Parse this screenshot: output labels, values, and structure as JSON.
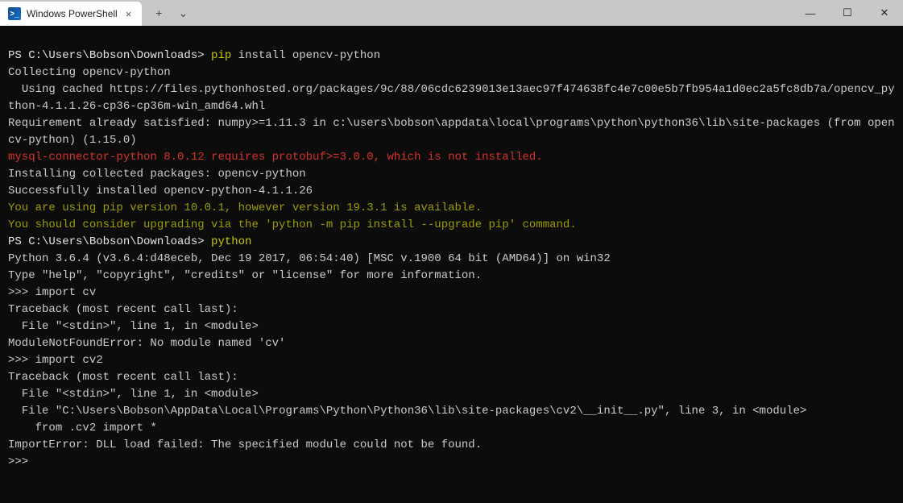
{
  "titlebar": {
    "tab_title": "Windows PowerShell",
    "tab_icon_text": ">_",
    "close_tab": "×",
    "new_tab": "+",
    "dropdown": "⌄",
    "minimize": "—",
    "maximize": "☐",
    "close": "✕"
  },
  "terminal": {
    "lines": [
      {
        "segments": [
          {
            "t": " ",
            "c": ""
          }
        ]
      },
      {
        "segments": [
          {
            "t": "PS C:\\Users\\Bobson\\Downloads> ",
            "c": "prompt-white"
          },
          {
            "t": "pip",
            "c": "c-yellow"
          },
          {
            "t": " install opencv-python",
            "c": ""
          }
        ]
      },
      {
        "segments": [
          {
            "t": "Collecting opencv-python",
            "c": ""
          }
        ]
      },
      {
        "segments": [
          {
            "t": "  Using cached https://files.pythonhosted.org/packages/9c/88/06cdc6239013e13aec97f474638fc4e7c00e5b7fb954a1d0ec2a5fc8db7a/opencv_python-4.1.1.26-cp36-cp36m-win_amd64.whl",
            "c": ""
          }
        ]
      },
      {
        "segments": [
          {
            "t": "Requirement already satisfied: numpy>=1.11.3 in c:\\users\\bobson\\appdata\\local\\programs\\python\\python36\\lib\\site-packages (from opencv-python) (1.15.0)",
            "c": ""
          }
        ]
      },
      {
        "segments": [
          {
            "t": "mysql-connector-python 8.0.12 requires protobuf>=3.0.0, which is not installed.",
            "c": "c-red"
          }
        ]
      },
      {
        "segments": [
          {
            "t": "Installing collected packages: opencv-python",
            "c": ""
          }
        ]
      },
      {
        "segments": [
          {
            "t": "Successfully installed opencv-python-4.1.1.26",
            "c": ""
          }
        ]
      },
      {
        "segments": [
          {
            "t": "You are using pip version 10.0.1, however version 19.3.1 is available.",
            "c": "c-dimyellow"
          }
        ]
      },
      {
        "segments": [
          {
            "t": "You should consider upgrading via the 'python -m pip install --upgrade pip' command.",
            "c": "c-dimyellow"
          }
        ]
      },
      {
        "segments": [
          {
            "t": "PS C:\\Users\\Bobson\\Downloads> ",
            "c": "prompt-white"
          },
          {
            "t": "python",
            "c": "c-yellow"
          }
        ]
      },
      {
        "segments": [
          {
            "t": "Python 3.6.4 (v3.6.4:d48eceb, Dec 19 2017, 06:54:40) [MSC v.1900 64 bit (AMD64)] on win32",
            "c": ""
          }
        ]
      },
      {
        "segments": [
          {
            "t": "Type \"help\", \"copyright\", \"credits\" or \"license\" for more information.",
            "c": ""
          }
        ]
      },
      {
        "segments": [
          {
            "t": ">>> import cv",
            "c": ""
          }
        ]
      },
      {
        "segments": [
          {
            "t": "Traceback (most recent call last):",
            "c": ""
          }
        ]
      },
      {
        "segments": [
          {
            "t": "  File \"<stdin>\", line 1, in <module>",
            "c": ""
          }
        ]
      },
      {
        "segments": [
          {
            "t": "ModuleNotFoundError: No module named 'cv'",
            "c": ""
          }
        ]
      },
      {
        "segments": [
          {
            "t": ">>> import cv2",
            "c": ""
          }
        ]
      },
      {
        "segments": [
          {
            "t": "Traceback (most recent call last):",
            "c": ""
          }
        ]
      },
      {
        "segments": [
          {
            "t": "  File \"<stdin>\", line 1, in <module>",
            "c": ""
          }
        ]
      },
      {
        "segments": [
          {
            "t": "  File \"C:\\Users\\Bobson\\AppData\\Local\\Programs\\Python\\Python36\\lib\\site-packages\\cv2\\__init__.py\", line 3, in <module>",
            "c": ""
          }
        ]
      },
      {
        "segments": [
          {
            "t": "    from .cv2 import *",
            "c": ""
          }
        ]
      },
      {
        "segments": [
          {
            "t": "ImportError: DLL load failed: The specified module could not be found.",
            "c": ""
          }
        ]
      },
      {
        "segments": [
          {
            "t": ">>>",
            "c": ""
          }
        ]
      }
    ]
  }
}
